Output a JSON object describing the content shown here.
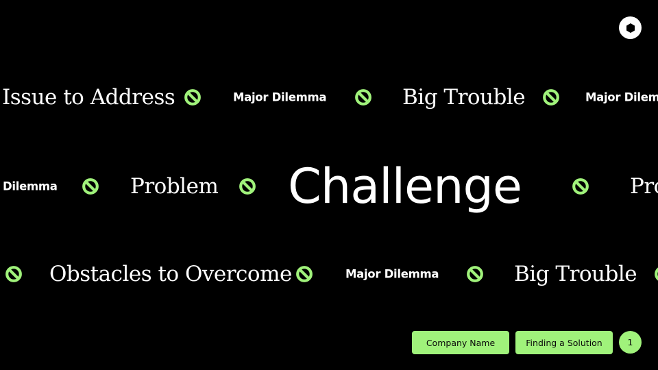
{
  "colors": {
    "background": "#000000",
    "accent": "#a0f27b",
    "text": "#ffffff"
  },
  "header": {
    "logo_icon": "hexagon-logo-icon"
  },
  "rows": [
    {
      "items": [
        {
          "type": "serif",
          "text": "Issue to Address"
        },
        {
          "type": "icon",
          "icon": "prohibited-icon"
        },
        {
          "type": "bold",
          "text": "Major Dilemma"
        },
        {
          "type": "icon",
          "icon": "prohibited-icon"
        },
        {
          "type": "serif",
          "text": "Big Trouble"
        },
        {
          "type": "icon",
          "icon": "prohibited-icon"
        },
        {
          "type": "bold",
          "text": "Major Dilem"
        }
      ]
    },
    {
      "items": [
        {
          "type": "bold",
          "text": "Dilemma"
        },
        {
          "type": "icon",
          "icon": "prohibited-icon"
        },
        {
          "type": "serif",
          "text": "Problem"
        },
        {
          "type": "icon",
          "icon": "prohibited-icon"
        },
        {
          "type": "big",
          "text": "Challenge"
        },
        {
          "type": "icon",
          "icon": "prohibited-icon"
        },
        {
          "type": "serif",
          "text": "Pro"
        }
      ]
    },
    {
      "items": [
        {
          "type": "icon",
          "icon": "prohibited-icon"
        },
        {
          "type": "serif",
          "text": "Obstacles to Overcome"
        },
        {
          "type": "icon",
          "icon": "prohibited-icon"
        },
        {
          "type": "bold",
          "text": "Major Dilemma"
        },
        {
          "type": "icon",
          "icon": "prohibited-icon"
        },
        {
          "type": "serif",
          "text": "Big Trouble"
        },
        {
          "type": "icon",
          "icon": "prohibited-icon"
        }
      ]
    }
  ],
  "footer": {
    "company_label": "Company Name",
    "section_label": "Finding a Solution",
    "page_number": "1"
  }
}
